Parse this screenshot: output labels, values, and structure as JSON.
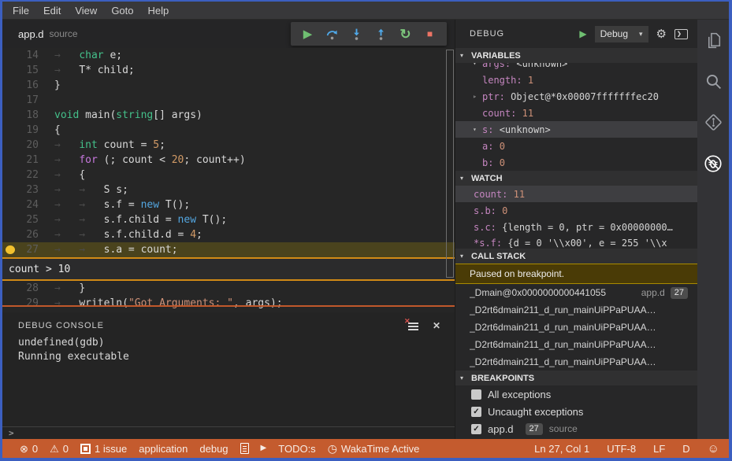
{
  "menu": {
    "items": [
      "File",
      "Edit",
      "View",
      "Goto",
      "Help"
    ]
  },
  "tab": {
    "title": "app.d",
    "subtitle": "source"
  },
  "debug_toolbar": {
    "buttons": [
      {
        "name": "continue",
        "kind": "play"
      },
      {
        "name": "step-over",
        "kind": "step-over"
      },
      {
        "name": "step-into",
        "kind": "step-into"
      },
      {
        "name": "step-out",
        "kind": "step-out"
      },
      {
        "name": "restart",
        "kind": "restart"
      },
      {
        "name": "stop",
        "kind": "stop"
      }
    ]
  },
  "editor": {
    "condition_widget": "count > 10",
    "lines": [
      {
        "num": "14",
        "segs": [
          [
            "ws",
            "→   "
          ],
          [
            "kw",
            "char"
          ],
          [
            "pl",
            " e;"
          ]
        ]
      },
      {
        "num": "15",
        "segs": [
          [
            "ws",
            "→   "
          ],
          [
            "pl",
            "T* child;"
          ]
        ]
      },
      {
        "num": "16",
        "segs": [
          [
            "pl",
            "}"
          ]
        ]
      },
      {
        "num": "17",
        "segs": []
      },
      {
        "num": "18",
        "segs": [
          [
            "kw",
            "void"
          ],
          [
            "pl",
            " main("
          ],
          [
            "kw",
            "string"
          ],
          [
            "pl",
            "[] args)"
          ]
        ]
      },
      {
        "num": "19",
        "segs": [
          [
            "pl",
            "{"
          ]
        ]
      },
      {
        "num": "20",
        "segs": [
          [
            "ws",
            "→   "
          ],
          [
            "kw",
            "int"
          ],
          [
            "pl",
            " count = "
          ],
          [
            "num",
            "5"
          ],
          [
            "pl",
            ";"
          ]
        ]
      },
      {
        "num": "21",
        "segs": [
          [
            "ws",
            "→   "
          ],
          [
            "ctl",
            "for"
          ],
          [
            "pl",
            " (; count < "
          ],
          [
            "num",
            "20"
          ],
          [
            "pl",
            "; count++)"
          ]
        ]
      },
      {
        "num": "22",
        "segs": [
          [
            "ws",
            "→   "
          ],
          [
            "pl",
            "{"
          ]
        ]
      },
      {
        "num": "23",
        "segs": [
          [
            "ws",
            "→   →   "
          ],
          [
            "pl",
            "S s;"
          ]
        ]
      },
      {
        "num": "24",
        "segs": [
          [
            "ws",
            "→   →   "
          ],
          [
            "pl",
            "s.f = "
          ],
          [
            "new",
            "new"
          ],
          [
            "pl",
            " T();"
          ]
        ]
      },
      {
        "num": "25",
        "segs": [
          [
            "ws",
            "→   →   "
          ],
          [
            "pl",
            "s.f.child = "
          ],
          [
            "new",
            "new"
          ],
          [
            "pl",
            " T();"
          ]
        ]
      },
      {
        "num": "26",
        "segs": [
          [
            "ws",
            "→   →   "
          ],
          [
            "pl",
            "s.f.child.d = "
          ],
          [
            "num",
            "4"
          ],
          [
            "pl",
            ";"
          ]
        ]
      },
      {
        "num": "27",
        "segs": [
          [
            "ws",
            "→   →   "
          ],
          [
            "pl",
            "s.a = count;"
          ]
        ],
        "current": true,
        "breakpoint": true
      },
      {
        "widget": true
      },
      {
        "num": "28",
        "segs": [
          [
            "ws",
            "→   "
          ],
          [
            "pl",
            "}"
          ]
        ]
      },
      {
        "num": "29",
        "segs": [
          [
            "ws",
            "→   "
          ],
          [
            "pl",
            "writeln("
          ],
          [
            "str",
            "\"Got Arguments: \""
          ],
          [
            "pl",
            ", args);"
          ]
        ]
      }
    ]
  },
  "console": {
    "title": "DEBUG CONSOLE",
    "lines": [
      "undefined(gdb)",
      "Running executable"
    ],
    "prompt": ">"
  },
  "sidebar": {
    "title": "DEBUG",
    "config_label": "Debug",
    "sections": {
      "variables": {
        "label": "VARIABLES",
        "rows": [
          {
            "name": "args",
            "value": "<unknown>",
            "arrow": "down",
            "indent": 0,
            "clipped": "top"
          },
          {
            "name": "length",
            "value": "1",
            "indent": 1
          },
          {
            "name": "ptr",
            "value": "Object@*0x00007fffffffec20",
            "arrow": "right",
            "indent": 1
          },
          {
            "name": "count",
            "value": "11",
            "indent": 1
          },
          {
            "name": "s",
            "value": "<unknown>",
            "arrow": "down",
            "indent": 0,
            "selected": true
          },
          {
            "name": "a",
            "value": "0",
            "indent": 1
          },
          {
            "name": "b",
            "value": "0",
            "indent": 1
          }
        ]
      },
      "watch": {
        "label": "WATCH",
        "rows": [
          {
            "name": "count",
            "value": "11",
            "selected": true
          },
          {
            "name": "s.b",
            "value": "0"
          },
          {
            "name": "s.c",
            "value": "{length = 0, ptr = 0x00000000…"
          },
          {
            "name": "*s.f",
            "value": "{d = 0 '\\\\x00', e = 255 '\\\\x",
            "clipped": "bottom"
          }
        ]
      },
      "call_stack": {
        "label": "CALL STACK",
        "message": "Paused on breakpoint.",
        "frames": [
          {
            "fn": "_Dmain@0x0000000000441055",
            "file": "app.d",
            "line": "27"
          },
          {
            "fn": "_D2rt6dmain211_d_run_mainUiPPaPUAA…"
          },
          {
            "fn": "_D2rt6dmain211_d_run_mainUiPPaPUAA…"
          },
          {
            "fn": "_D2rt6dmain211_d_run_mainUiPPaPUAA…"
          },
          {
            "fn": "_D2rt6dmain211_d_run_mainUiPPaPUAA…"
          }
        ]
      },
      "breakpoints": {
        "label": "BREAKPOINTS",
        "rows": [
          {
            "checked": false,
            "label": "All exceptions"
          },
          {
            "checked": true,
            "label": "Uncaught exceptions"
          },
          {
            "checked": true,
            "label": "app.d",
            "badge": "27",
            "suffix": "source"
          }
        ]
      }
    }
  },
  "activity_bar": {
    "items": [
      "explorer",
      "search",
      "source-control",
      "debug"
    ],
    "active": "debug"
  },
  "status_bar": {
    "left": [
      {
        "icon": "error-icon",
        "text": "0"
      },
      {
        "icon": "warning-icon",
        "text": "0"
      },
      {
        "icon": "frame-icon",
        "text": "1 issue"
      },
      {
        "text": "application"
      },
      {
        "text": "debug"
      },
      {
        "icon": "file-icon"
      },
      {
        "icon": "play-icon"
      },
      {
        "text": "TODO:s"
      },
      {
        "icon": "clock-icon",
        "text": "WakaTime Active"
      }
    ],
    "right": [
      {
        "text": "Ln 27, Col 1"
      },
      {
        "text": "UTF-8"
      },
      {
        "text": "LF"
      },
      {
        "text": "D"
      },
      {
        "icon": "smiley-icon"
      }
    ]
  },
  "colors": {
    "window_border": "#3c5fc0",
    "status_bar": "#c45b2e",
    "breakpoint": "#f2c12e",
    "line_highlight": "#4a431d",
    "widget_border": "#d18a16",
    "paused_banner_border": "#a98b00"
  }
}
